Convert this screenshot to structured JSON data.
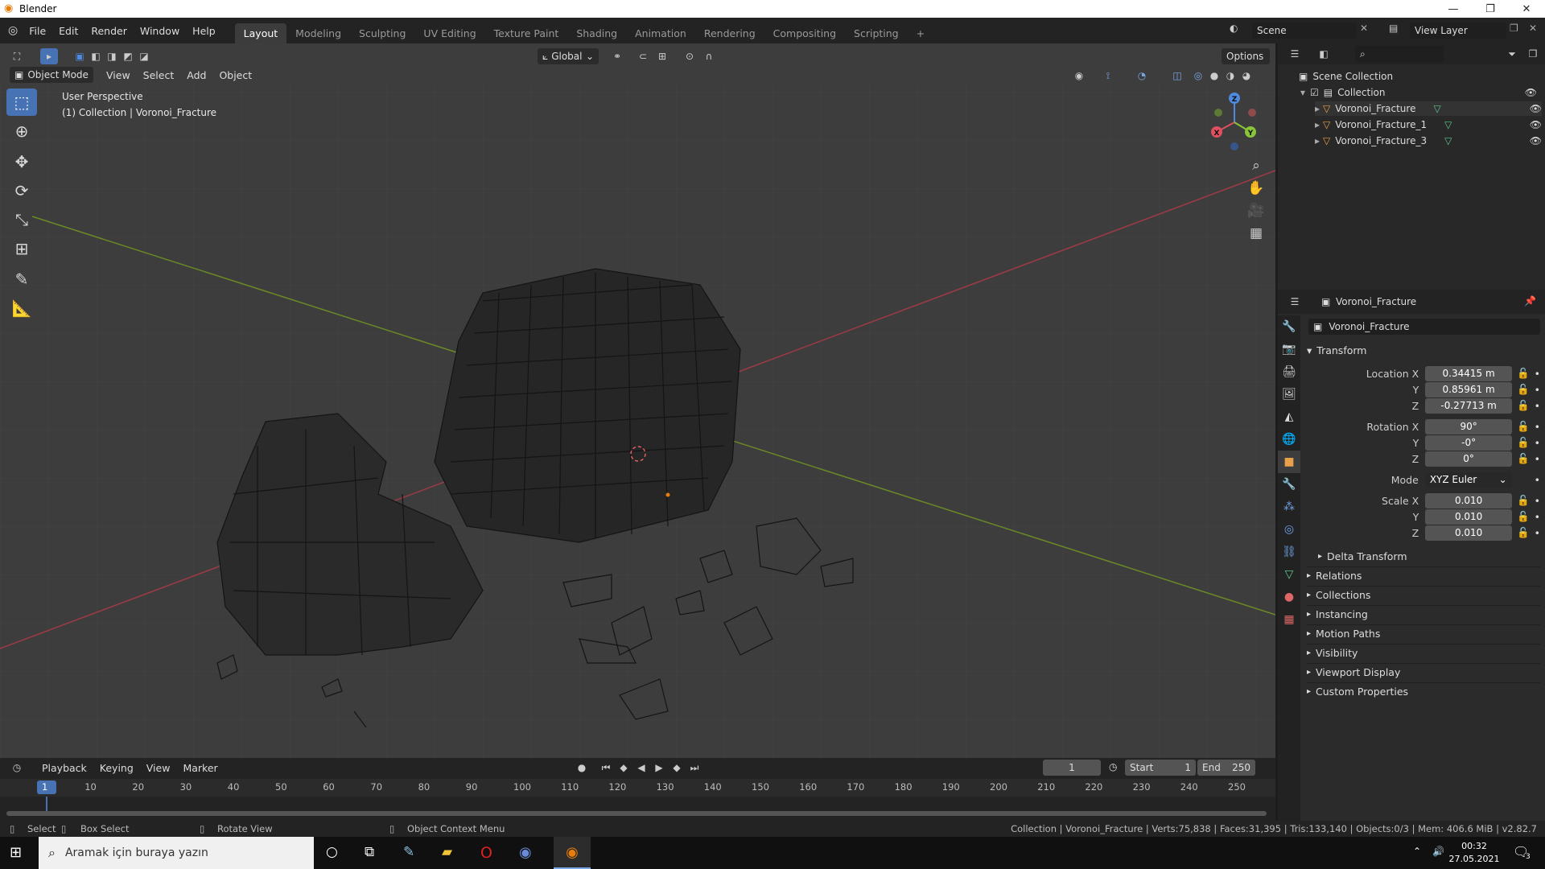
{
  "window": {
    "title": "Blender"
  },
  "menus": [
    "File",
    "Edit",
    "Render",
    "Window",
    "Help"
  ],
  "workspaces": [
    "Layout",
    "Modeling",
    "Sculpting",
    "UV Editing",
    "Texture Paint",
    "Shading",
    "Animation",
    "Rendering",
    "Compositing",
    "Scripting"
  ],
  "active_workspace": "Layout",
  "scene": {
    "name": "Scene",
    "view_layer": "View Layer"
  },
  "viewport": {
    "mode": "Object Mode",
    "menus": [
      "View",
      "Select",
      "Add",
      "Object"
    ],
    "transform_orientation": "Global",
    "options_label": "Options",
    "overlay_line1": "User Perspective",
    "overlay_line2": "(1) Collection | Voronoi_Fracture",
    "axes": {
      "x": "X",
      "y": "Y",
      "z": "Z"
    }
  },
  "outliner": {
    "root": "Scene Collection",
    "collection": "Collection",
    "items": [
      "Voronoi_Fracture",
      "Voronoi_Fracture_1",
      "Voronoi_Fracture_3"
    ]
  },
  "properties": {
    "object_name": "Voronoi_Fracture",
    "field_name": "Voronoi_Fracture",
    "transform_label": "Transform",
    "location": {
      "label": "Location X",
      "x": "0.34415 m",
      "y": "0.85961 m",
      "z": "-0.27713 m"
    },
    "rotation": {
      "label": "Rotation X",
      "x": "90°",
      "y": "-0°",
      "z": "0°"
    },
    "mode": {
      "label": "Mode",
      "value": "XYZ Euler"
    },
    "scale": {
      "label": "Scale X",
      "x": "0.010",
      "y": "0.010",
      "z": "0.010"
    },
    "axis_y": "Y",
    "axis_z": "Z",
    "delta_transform": "Delta Transform",
    "sections": [
      "Relations",
      "Collections",
      "Instancing",
      "Motion Paths",
      "Visibility",
      "Viewport Display",
      "Custom Properties"
    ]
  },
  "timeline": {
    "menus": [
      "Playback",
      "Keying",
      "View",
      "Marker"
    ],
    "current_frame": "1",
    "start_label": "Start",
    "start": "1",
    "end_label": "End",
    "end": "250",
    "ticks": [
      "1",
      "10",
      "20",
      "30",
      "40",
      "50",
      "60",
      "70",
      "80",
      "90",
      "100",
      "110",
      "120",
      "130",
      "140",
      "150",
      "160",
      "170",
      "180",
      "190",
      "200",
      "210",
      "220",
      "230",
      "240",
      "250"
    ]
  },
  "statusbar": {
    "select": "Select",
    "box_select": "Box Select",
    "rotate_view": "Rotate View",
    "context_menu": "Object Context Menu",
    "stats": "Collection | Voronoi_Fracture | Verts:75,838 | Faces:31,395 | Tris:133,140 | Objects:0/3 | Mem: 406.6 MiB | v2.82.7"
  },
  "taskbar": {
    "search_placeholder": "Aramak için buraya yazın",
    "time": "00:32",
    "date": "27.05.2021",
    "notif_count": "3"
  }
}
